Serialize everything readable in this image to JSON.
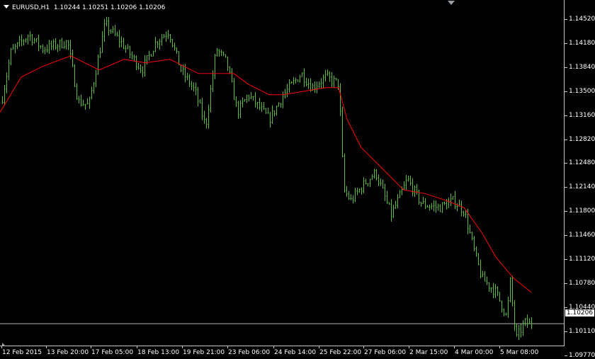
{
  "header": {
    "symbol": "EURUSD,H1",
    "quote": "1.10244 1.10251 1.10206 1.10206"
  },
  "price_axis": {
    "labels": [
      "1.14520",
      "1.14180",
      "1.13840",
      "1.13500",
      "1.13160",
      "1.12820",
      "1.12480",
      "1.12140",
      "1.11800",
      "1.11460",
      "1.11120",
      "1.10780",
      "1.10440",
      "1.10110",
      "1.09770"
    ],
    "bid_price": "1.10206"
  },
  "time_axis": {
    "labels": [
      "12 Feb 2015",
      "13 Feb 20:00",
      "17 Feb 05:00",
      "18 Feb 13:00",
      "19 Feb 21:00",
      "23 Feb 06:00",
      "24 Feb 14:00",
      "25 Feb 22:00",
      "27 Feb 06:00",
      "2 Mar 15:00",
      "4 Mar 00:00",
      "5 Mar 08:00"
    ]
  },
  "colors": {
    "background": "#000000",
    "bars": "#5dbb3e",
    "moving_average": "#ff0000",
    "bid_line": "#b4b4b4",
    "axis_text": "#ffffff"
  },
  "chart_data": {
    "type": "ohlc",
    "symbol": "EURUSD",
    "timeframe": "H1",
    "ylim": [
      1.0966,
      1.1462
    ],
    "x": [
      "12 Feb 2015",
      "13 Feb 20:00",
      "17 Feb 05:00",
      "18 Feb 13:00",
      "19 Feb 21:00",
      "23 Feb 06:00",
      "24 Feb 14:00",
      "25 Feb 22:00",
      "27 Feb 06:00",
      "2 Mar 15:00",
      "4 Mar 00:00",
      "5 Mar 08:00"
    ],
    "close_approx": [
      1.133,
      1.14,
      1.136,
      1.139,
      1.134,
      1.133,
      1.1345,
      1.135,
      1.123,
      1.119,
      1.115,
      1.102
    ],
    "moving_average_approx": [
      1.132,
      1.139,
      1.1385,
      1.139,
      1.138,
      1.1365,
      1.135,
      1.1345,
      1.129,
      1.122,
      1.1185,
      1.1075
    ],
    "bid_price": 1.10206,
    "grid": false
  }
}
